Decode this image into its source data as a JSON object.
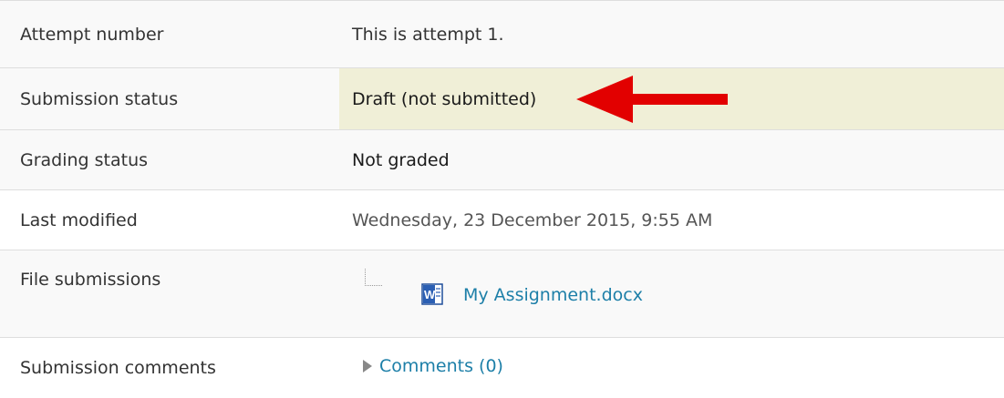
{
  "rows": [
    {
      "label": "Attempt number",
      "value": "This is attempt 1."
    },
    {
      "label": "Submission status",
      "value": "Draft (not submitted)"
    },
    {
      "label": "Grading status",
      "value": "Not graded"
    },
    {
      "label": "Last modified",
      "value": "Wednesday, 23 December 2015, 9:55 AM"
    },
    {
      "label": "File submissions",
      "file": {
        "name": "My Assignment.docx",
        "icon": "word-doc-icon"
      }
    },
    {
      "label": "Submission comments",
      "value": "Comments (0)",
      "icon": "expand-triangle-icon"
    }
  ],
  "colors": {
    "highlight": "#f0efd7",
    "link": "#1d7fa8",
    "arrow": "#e20000"
  },
  "annotation": {
    "icon": "red-arrow-icon"
  }
}
